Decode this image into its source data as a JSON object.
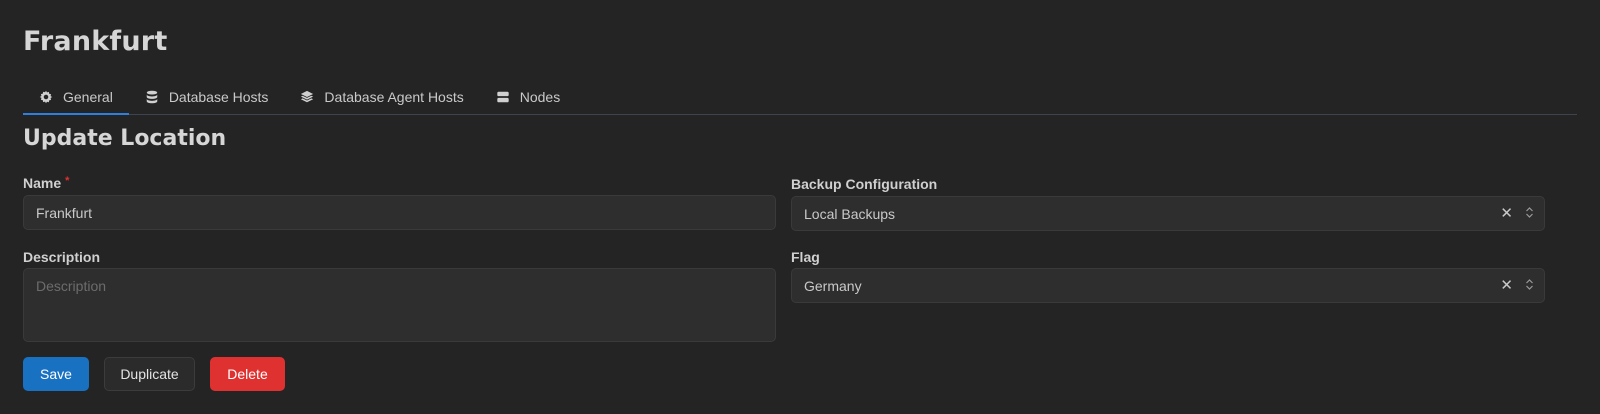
{
  "page": {
    "title": "Frankfurt"
  },
  "tabs": [
    {
      "label": "General",
      "icon": "gear-icon",
      "active": true
    },
    {
      "label": "Database Hosts",
      "icon": "database-icon",
      "active": false
    },
    {
      "label": "Database Agent Hosts",
      "icon": "layers-icon",
      "active": false
    },
    {
      "label": "Nodes",
      "icon": "server-icon",
      "active": false
    }
  ],
  "form": {
    "heading": "Update Location",
    "name": {
      "label": "Name",
      "required_mark": "*",
      "value": "Frankfurt"
    },
    "description": {
      "label": "Description",
      "placeholder": "Description",
      "value": ""
    },
    "backup": {
      "label": "Backup Configuration",
      "value": "Local Backups",
      "clear": "✕"
    },
    "flag": {
      "label": "Flag",
      "value": "Germany",
      "clear": "✕"
    }
  },
  "actions": {
    "save": "Save",
    "duplicate": "Duplicate",
    "delete": "Delete"
  },
  "colors": {
    "accent": "#1971c2",
    "danger": "#e03131",
    "background": "#242424"
  }
}
